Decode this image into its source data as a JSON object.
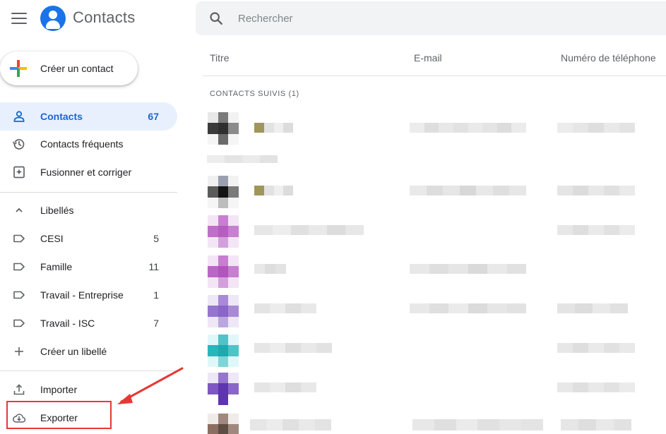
{
  "app": {
    "title": "Contacts",
    "menu_icon": "hamburger-menu-icon",
    "logo_icon": "contacts-logo-icon"
  },
  "sidebar": {
    "create_contact_label": "Créer un contact",
    "items": [
      {
        "label": "Contacts",
        "count": "67",
        "icon": "person-icon",
        "active": true
      },
      {
        "label": "Contacts fréquents",
        "count": "",
        "icon": "history-icon"
      },
      {
        "label": "Fusionner et corriger",
        "count": "",
        "icon": "merge-fix-icon"
      }
    ],
    "labels_header": "Libellés",
    "labels": [
      {
        "label": "CESI",
        "count": "5",
        "icon": "label-icon"
      },
      {
        "label": "Famille",
        "count": "11",
        "icon": "label-icon"
      },
      {
        "label": "Travail - Entreprise",
        "count": "1",
        "icon": "label-icon"
      },
      {
        "label": "Travail - ISC",
        "count": "7",
        "icon": "label-icon"
      }
    ],
    "create_label": "Créer un libellé",
    "import_label": "Importer",
    "export_label": "Exporter"
  },
  "search": {
    "placeholder": "Rechercher"
  },
  "table": {
    "columns": [
      "Titre",
      "E-mail",
      "Numéro de téléphone"
    ],
    "section": "CONTACTS SUIVIS (1)"
  },
  "colors": {
    "accent": "#1a73e8",
    "active_bg": "#e8f0fe",
    "annotation": "#e53935"
  }
}
